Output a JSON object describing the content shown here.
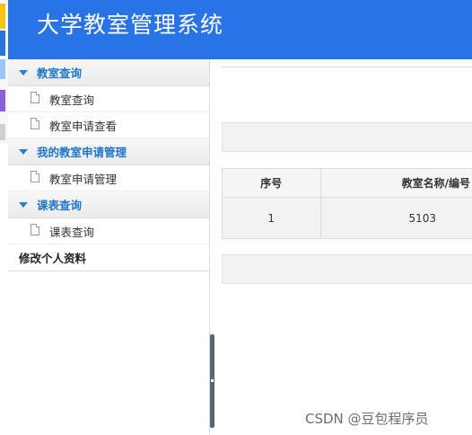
{
  "header": {
    "title": "大学教室管理系统"
  },
  "sidebar": {
    "groups": [
      {
        "label": "教室查询",
        "items": [
          "教室查询",
          "教室申请查看"
        ]
      },
      {
        "label": "我的教室申请管理",
        "items": [
          "教室申请管理"
        ]
      },
      {
        "label": "课表查询",
        "items": [
          "课表查询"
        ]
      },
      {
        "label": "修改个人资料",
        "items": []
      }
    ]
  },
  "table": {
    "headers": [
      "序号",
      "教室名称/编号"
    ],
    "rows": [
      [
        "1",
        "5103"
      ]
    ]
  },
  "watermark": "CSDN @豆包程序员",
  "colors": {
    "header": "#2873e6",
    "accent": "#1f75c8"
  }
}
